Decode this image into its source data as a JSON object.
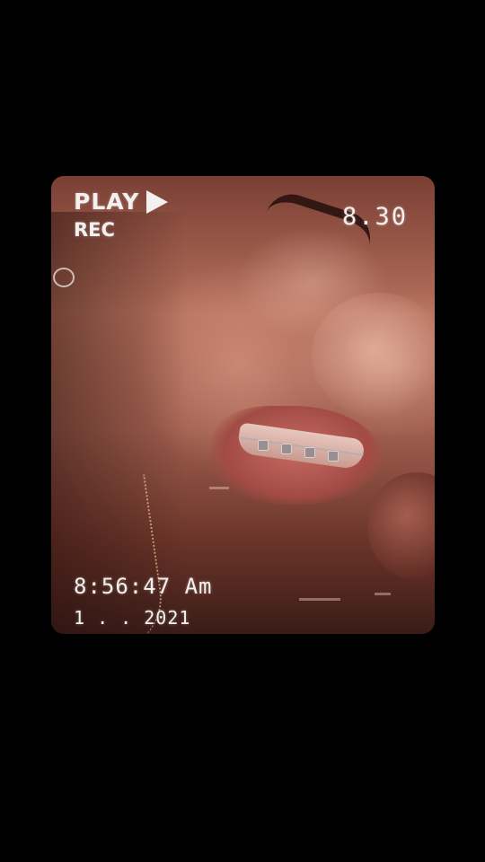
{
  "overlay": {
    "play_label": "PLAY",
    "rec_label": "REC",
    "counter": "8.30",
    "time": "8:56:47 Am",
    "date": "1 . . 2021"
  },
  "icons": {
    "play": "play-triangle-icon"
  }
}
